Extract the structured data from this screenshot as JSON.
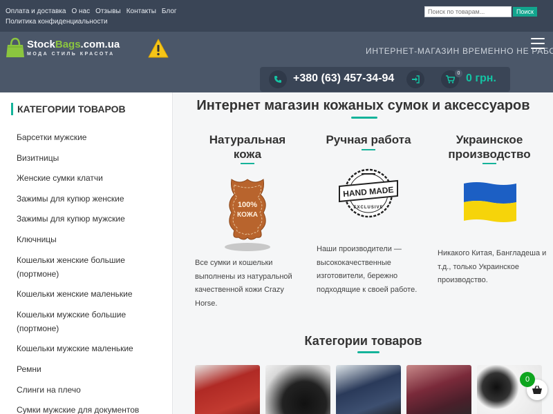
{
  "topbar": {
    "links": [
      "Оплата и доставка",
      "О нас",
      "Отзывы",
      "Контакты",
      "Блог",
      "Политика конфиденциальности"
    ],
    "search_placeholder": "Поиск по товарам...",
    "search_button": "Поиск"
  },
  "header": {
    "logo_prefix": "Stock",
    "logo_brand": "Bags",
    "logo_suffix": ".com.ua",
    "logo_tagline": "МОДА  СТИЛЬ  КРАСОТА",
    "marquee": "ИНТЕРНЕТ-МАГАЗИН ВРЕМЕННО НЕ РАБОТАЕТ",
    "phone": "+380 (63) 457-34-94",
    "cart_count": "0",
    "cart_total": "0 грн."
  },
  "sidebar": {
    "title": "КАТЕГОРИИ ТОВАРОВ",
    "items": [
      "Барсетки мужские",
      "Визитницы",
      "Женские сумки клатчи",
      "Зажимы для купюр женские",
      "Зажимы для купюр мужские",
      "Ключницы",
      "Кошельки женские большие (портмоне)",
      "Кошельки женские маленькие",
      "Кошельки мужские большие (портмоне)",
      "Кошельки мужские маленькие",
      "Ремни",
      "Слинги на плечо",
      "Сумки мужские для документов"
    ]
  },
  "main": {
    "title": "Интернет магазин кожаных сумок и аксессуаров",
    "features": [
      {
        "title_line1": "Натуральная",
        "title_line2": "кожа",
        "badge_line1": "100%",
        "badge_line2": "КОЖА",
        "text": "Все сумки и кошельки выполнены из натуральной качественной кожи Crazy Horse."
      },
      {
        "title_line1": "Ручная работа",
        "title_line2": "",
        "badge_top": "HAND MADE",
        "badge_bottom": "EXCLUSIVE",
        "text": "Наши производители — высококачественные изготовители, бережно подходящие к своей работе."
      },
      {
        "title_line1": "Украинское",
        "title_line2": "производство",
        "text": "Никакого Китая, Бангладеша и т.д., только Украинское производство."
      }
    ],
    "categories_title": "Категории товаров"
  },
  "floating_cart": {
    "count": "0"
  },
  "colors": {
    "topbar": "#3a4556",
    "header": "#4b5769",
    "accent": "#14b39a",
    "price": "#14c4a4",
    "warning": "#f5c518",
    "flag_blue": "#1c5fc4",
    "flag_yellow": "#f6d40a"
  },
  "icons": [
    "shopping-bag-logo-icon",
    "warning-icon",
    "menu-icon",
    "phone-icon",
    "login-icon",
    "cart-icon"
  ]
}
